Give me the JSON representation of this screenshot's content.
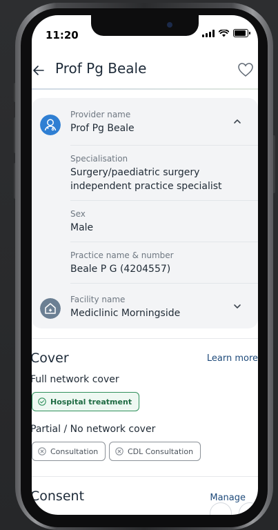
{
  "status_bar": {
    "time": "11:20"
  },
  "header": {
    "title": "Prof Pg Beale",
    "back_icon": "arrow-left-icon",
    "favourite_icon": "heart-outline-icon"
  },
  "provider_card": {
    "provider_name_label": "Provider name",
    "provider_name_value": "Prof Pg Beale",
    "specialisation_label": "Specialisation",
    "specialisation_value_line1": "Surgery/paediatric surgery",
    "specialisation_value_line2": "independent practice specialist",
    "sex_label": "Sex",
    "sex_value": "Male",
    "practice_label": "Practice name & number",
    "practice_value": "Beale P G (4204557)",
    "facility_label": "Facility name",
    "facility_value": "Mediclinic Morningside"
  },
  "cover": {
    "title": "Cover",
    "learn_more": "Learn more",
    "full_network_title": "Full network cover",
    "full_network_chips": [
      "Hospital treatment"
    ],
    "partial_network_title": "Partial / No network cover",
    "partial_network_chips": [
      "Consultation",
      "CDL Consultation"
    ]
  },
  "consent": {
    "title": "Consent",
    "manage": "Manage"
  },
  "colors": {
    "accent_blue": "#1e4a7a",
    "provider_icon_bg": "#2f7fd3",
    "facility_icon_bg": "#6b7f93",
    "green": "#2f8f5b"
  }
}
